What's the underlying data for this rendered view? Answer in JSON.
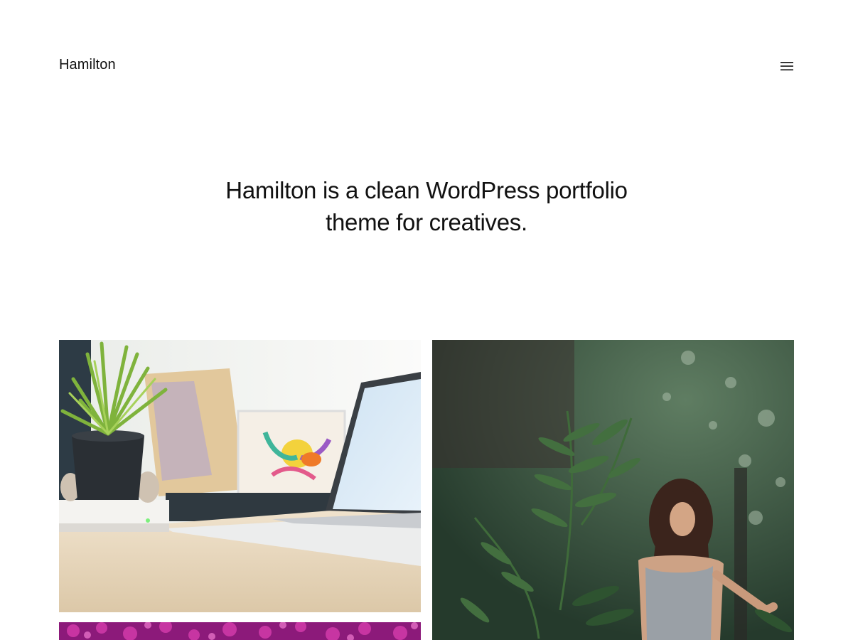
{
  "header": {
    "site_title": "Hamilton",
    "menu_icon": "hamburger-menu-icon"
  },
  "hero": {
    "tagline": "Hamilton is a clean WordPress portfolio theme for creatives."
  },
  "portfolio": {
    "items": [
      {
        "image": "desk-with-plant-and-laptop"
      },
      {
        "image": "woman-in-green-forest"
      },
      {
        "image": "pink-flowers"
      }
    ]
  },
  "colors": {
    "text": "#111111",
    "background": "#ffffff"
  }
}
